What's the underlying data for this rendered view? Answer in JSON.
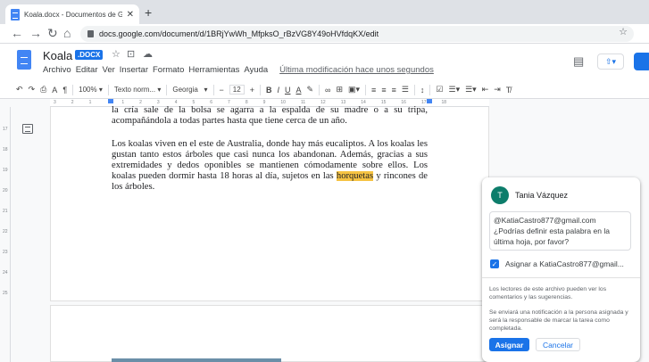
{
  "browser": {
    "tab_title": "Koala.docx - Documentos de Go",
    "url": "docs.google.com/document/d/1BRjYwWh_MfpksO_rBzVG8Y49oHVfdqKX/edit"
  },
  "doc": {
    "title": "Koala",
    "badge": ".DOCX",
    "last_edit": "Última modificación hace unos segundos"
  },
  "menu": [
    "Archivo",
    "Editar",
    "Ver",
    "Insertar",
    "Formato",
    "Herramientas",
    "Ayuda"
  ],
  "toolbar": {
    "zoom": "100%",
    "style": "Texto norm...",
    "font": "Georgia",
    "font_size": "12"
  },
  "ruler": {
    "marks": [
      "3",
      "2",
      "1",
      "",
      "1",
      "2",
      "3",
      "4",
      "5",
      "6",
      "7",
      "8",
      "9",
      "10",
      "11",
      "12",
      "13",
      "14",
      "15",
      "16",
      "17",
      "18"
    ],
    "vmarks": [
      "17",
      "18",
      "19",
      "20",
      "21",
      "22",
      "23",
      "24",
      "25"
    ]
  },
  "content": {
    "p1": "la cría sale de la bolsa se agarra a la espalda de su madre o a su tripa, acompañándola a todas partes hasta que tiene cerca de un año.",
    "p2_before": "Los koalas viven en el este de Australia, donde hay más eucaliptos. A los koalas les gustan tanto estos árboles que casi nunca los abandonan. Además, gracias a sus extremidades y dedos oponibles se mantienen cómodamente sobre ellos. Los koalas pueden dormir hasta 18 horas al día, sujetos en las ",
    "p2_highlight": "horquetas",
    "p2_after": " y rincones de los árboles."
  },
  "comment": {
    "avatar_initial": "T",
    "avatar_color": "#0d7d6b",
    "author": "Tania Vázquez",
    "text": "@KatiaCastro877@gmail.com ¿Podrías definir esta palabra en la última hoja, por favor?",
    "assign_checked": true,
    "assign_label": "Asignar a KatiaCastro877@gmail...",
    "note1": "Los lectores de este archivo pueden ver los comentarios y las sugerencias.",
    "note2": "Se enviará una notificación a la persona asignada y será la responsable de marcar la tarea como completada.",
    "assign_button": "Asignar",
    "cancel_button": "Cancelar"
  },
  "colors": {
    "accent": "#1a73e8",
    "highlight": "#f6c343"
  }
}
